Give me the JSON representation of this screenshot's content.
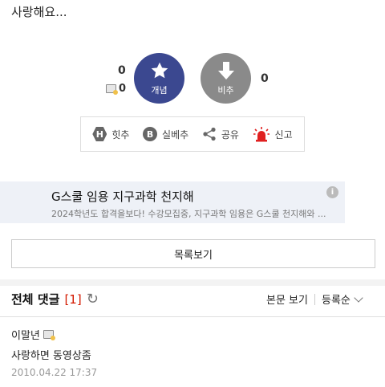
{
  "post": {
    "text": "사랑해요..."
  },
  "vote": {
    "up_count": "0",
    "up_sub_count": "0",
    "up_label": "개념",
    "down_label": "비추",
    "down_count": "0",
    "up_color": "#3b4890",
    "down_color": "#8a8a8a"
  },
  "actions": [
    {
      "icon_letter": "H",
      "label": "힛추",
      "icon": "hit-icon"
    },
    {
      "icon_letter": "B",
      "label": "실베추",
      "icon": "best-icon"
    },
    {
      "label": "공유",
      "icon": "share-icon"
    },
    {
      "label": "신고",
      "icon": "siren-icon"
    }
  ],
  "ad": {
    "title": "G스쿨 임용 지구과학 천지해",
    "description": "2024학년도 합격을보다! 수강모집중, 지구과학 임용은 G스쿨 천지해와 ...",
    "info_symbol": "i"
  },
  "list_button": {
    "label": "목록보기"
  },
  "comments_header": {
    "title": "전체 댓글",
    "count": "[1]",
    "view_post": "본문 보기",
    "sort": "등록순"
  },
  "comments": [
    {
      "author": "이말년",
      "body": "사랑하면 동영상좀",
      "date": "2010.04.22 17:37"
    }
  ]
}
